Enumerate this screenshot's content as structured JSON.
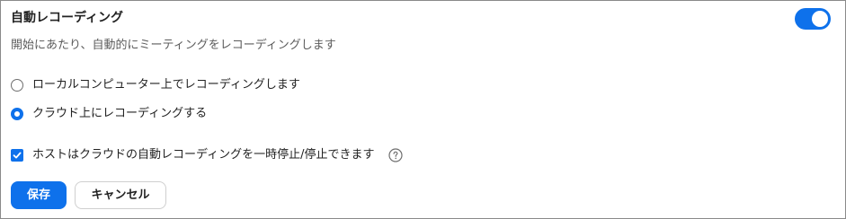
{
  "setting": {
    "title": "自動レコーディング",
    "description": "開始にあたり、自動的にミーティングをレコーディングします",
    "toggle_on": true
  },
  "options": {
    "local_label": "ローカルコンピューター上でレコーディングします",
    "cloud_label": "クラウド上にレコーディングする",
    "selected": "cloud"
  },
  "host_option": {
    "label": "ホストはクラウドの自動レコーディングを一時停止/停止できます",
    "checked": true,
    "help_icon": "question-circle-icon"
  },
  "buttons": {
    "save_label": "保存",
    "cancel_label": "キャンセル"
  },
  "colors": {
    "accent": "#0e71eb"
  }
}
